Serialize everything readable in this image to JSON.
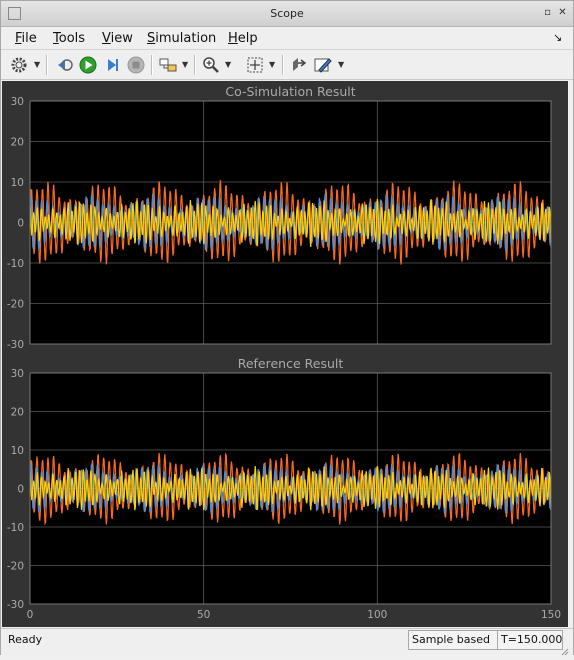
{
  "window": {
    "title": "Scope"
  },
  "menu": [
    {
      "label": "File",
      "u": "F",
      "rest": "ile"
    },
    {
      "label": "Tools",
      "u": "T",
      "rest": "ools"
    },
    {
      "label": "View",
      "u": "V",
      "rest": "iew"
    },
    {
      "label": "Simulation",
      "u": "S",
      "rest": "imulation"
    },
    {
      "label": "Help",
      "u": "H",
      "rest": "elp"
    }
  ],
  "toolbar_icons": [
    "gear-icon",
    "step-back-icon",
    "run-icon",
    "step-forward-icon",
    "stop-icon",
    "highlight-block-icon",
    "zoom-in-icon",
    "fit-to-view-icon",
    "restore-layout-icon",
    "style-icon"
  ],
  "status": {
    "text": "Ready",
    "mode": "Sample based",
    "time": "T=150.000"
  },
  "colors": {
    "background": "#000000",
    "frame": "#333333",
    "axis_text": "#aaaaaa",
    "grid": "#5a5a5a",
    "series": [
      "#ffd200",
      "#4c8ed8",
      "#ff6a19"
    ]
  },
  "chart_data": [
    {
      "type": "line",
      "title": "Co-Simulation Result",
      "xlim": [
        0,
        150
      ],
      "ylim": [
        -30,
        30
      ],
      "xticks": [],
      "yticks": [
        30,
        20,
        10,
        0,
        -10,
        -20,
        -30
      ],
      "grid": true,
      "legend": "none",
      "series": [
        {
          "color": "#ff6a19",
          "amplitude": 9.5,
          "period": 1.6
        },
        {
          "color": "#4c8ed8",
          "amplitude": 6.5,
          "period": 1.6
        },
        {
          "color": "#ffd200",
          "amplitude": 4.5,
          "period": 1.1
        }
      ]
    },
    {
      "type": "line",
      "title": "Reference Result",
      "xlim": [
        0,
        150
      ],
      "ylim": [
        -30,
        30
      ],
      "xticks": [
        0,
        50,
        100,
        150
      ],
      "yticks": [
        30,
        20,
        10,
        0,
        -10,
        -20,
        -30
      ],
      "grid": true,
      "legend": "none",
      "series": [
        {
          "color": "#ff6a19",
          "amplitude": 8.5,
          "period": 1.6
        },
        {
          "color": "#4c8ed8",
          "amplitude": 6.0,
          "period": 1.6
        },
        {
          "color": "#ffd200",
          "amplitude": 4.5,
          "period": 1.1
        }
      ]
    }
  ]
}
